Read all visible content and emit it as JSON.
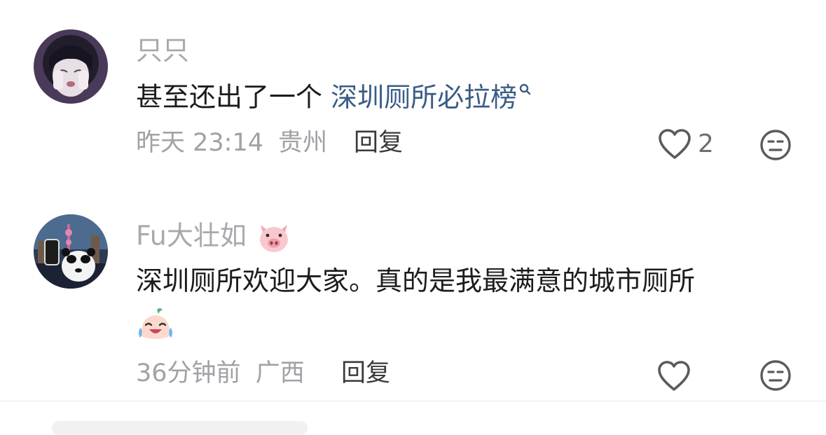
{
  "comments": [
    {
      "username": "只只",
      "text_prefix": "甚至还出了一个 ",
      "text_link": "深圳厕所必拉榜",
      "time": "昨天 23:14",
      "location": "贵州",
      "reply_label": "回复",
      "like_count": "2",
      "icons": [
        "avatar",
        "search-icon",
        "heart-icon",
        "emoji-icon"
      ]
    },
    {
      "username": "Fu大壮如",
      "username_emoji": "pig-face-emoji",
      "text": "深圳厕所欢迎大家。真的是我最满意的城市厕所",
      "text_emoji": "laughing-crying-emoji",
      "time": "36分钟前",
      "location": "广西",
      "reply_label": "回复",
      "icons": [
        "avatar",
        "heart-icon",
        "emoji-icon"
      ]
    }
  ],
  "colors": {
    "username": "#a9a9ad",
    "text": "#1c1c1e",
    "link": "#3a5c86",
    "meta": "#a1a1a6",
    "reply": "#3a3a3c",
    "icon": "#5a5a5e"
  }
}
